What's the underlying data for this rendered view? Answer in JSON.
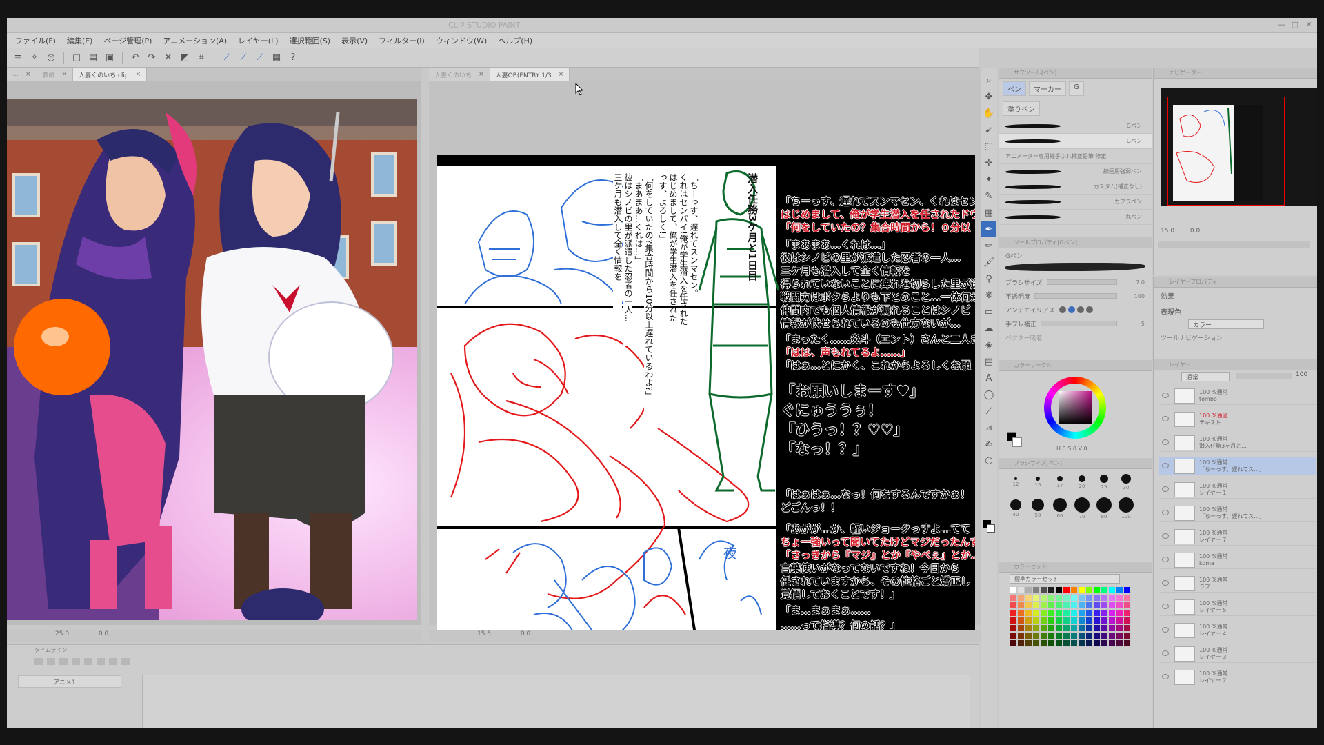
{
  "window": {
    "title": "CLIP STUDIO PAINT"
  },
  "menu": [
    "ファイル(F)",
    "編集(E)",
    "ページ管理(P)",
    "アニメーション(A)",
    "レイヤー(L)",
    "選択範囲(S)",
    "表示(V)",
    "フィルター(I)",
    "ウィンドウ(W)",
    "ヘルプ(H)"
  ],
  "left_doc": {
    "tabs": [
      {
        "label": "…",
        "close": "×"
      },
      {
        "label": "表紙",
        "close": "×"
      },
      {
        "label": "人妻くのいち.clip",
        "close": "×"
      }
    ],
    "status": {
      "zoom": "25.0",
      "angle": "0.0"
    }
  },
  "right_doc": {
    "tabs": [
      {
        "label": "人妻くのいち",
        "close": "×"
      },
      {
        "label": "人妻OB(ENTRY 1/3",
        "close": "×"
      }
    ],
    "status": {
      "zoom": "15.5",
      "angle": "0.0"
    },
    "vertical_text": {
      "title": "潜入任務3ケ月と1日目",
      "col1": "「ちーっす、遅れてスンマセン。",
      "col2": "くれはセンパイ!俺が学生潜入を任された",
      "col3": "はじめまして、俺が学生潜入を任された",
      "col4": "っす、よろしく!」",
      "col5": "「何をしていたの?集合時間から10分以上遅れているわよ?」",
      "col6": "「まあまあ…くれは…」",
      "col7": "彼はシノビの里が派遣した忍者の一人…",
      "col8": "三ケ月も潜入して全く情報を"
    },
    "dialogue_right": [
      {
        "text": "「ちーっす、遅れてスンマセン、くれはセンパ",
        "color": "black"
      },
      {
        "text": "はじめまして、俺が学生潜入を任されたドウ",
        "color": "red"
      },
      {
        "text": "「何をしていたの？集合時間から！０分以",
        "color": "red"
      },
      {
        "text": "「まあまあ…くれは…」",
        "color": "black"
      },
      {
        "text": "彼はシノビの里が派遣した忍者の一人…",
        "color": "black"
      },
      {
        "text": "三ケ月も潜入して全く情報を",
        "color": "black"
      },
      {
        "text": "得られていないことに痺れを切らした里が送",
        "color": "black"
      },
      {
        "text": "戦闘力はボクらよりも下とのこと…一体何が",
        "color": "black"
      },
      {
        "text": "仲間内でも個人情報が漏れることはシノビ",
        "color": "black"
      },
      {
        "text": "情報が伏せられているのも仕方ないが…",
        "color": "black"
      },
      {
        "text": "「まったく……炎斗（エント）さんと二人き",
        "color": "black"
      },
      {
        "text": "「はは、声もれてるよ……」",
        "color": "red"
      },
      {
        "text": "「はぁ…とにかく、これからよろしくお願",
        "color": "black"
      }
    ],
    "dialogue_big": [
      "「お願いしまーす♥」",
      "ぐにゅううぅ！",
      "「ひうっ！？♡♡」",
      "「なっ！？」"
    ],
    "dialogue_lower": [
      {
        "text": "「はぁはぁ…なっ！何をするんですかぁ！",
        "color": "black"
      },
      {
        "text": "どごんっ！！",
        "color": "black"
      },
      {
        "text": "「あがが…か、軽いジョークっすよ…てて",
        "color": "black"
      },
      {
        "text": "ちょ一強いって聞いてたけどマジだったんす",
        "color": "red"
      },
      {
        "text": "「さっきから『マジ』とか『やべぇ』とか…",
        "color": "red"
      },
      {
        "text": "言葉使いがなってないですね！今日から",
        "color": "black"
      },
      {
        "text": "任されていますから、その性格ごと矯正し",
        "color": "black"
      },
      {
        "text": "覚悟しておくことです！」",
        "color": "black"
      },
      {
        "text": "「ま…まぁまぁ……",
        "color": "black"
      },
      {
        "text": "……って指導？何の話？」",
        "color": "black"
      }
    ],
    "sketch_note": "夜"
  },
  "timeline": {
    "title": "タイムライン",
    "track": "アニメ1"
  },
  "subtool": {
    "header": "サブツール[ペン]",
    "tabs": [
      "ペン",
      "マーカー",
      "G"
    ],
    "tab_fill": "塗りペン",
    "brushes": [
      "Gペン",
      "Gペン",
      "アニメーター専用線手ぶれ補正鉛筆 修正",
      "線画用強弱ペン",
      "カスタム(補正なし)",
      "カブラペン",
      "丸ペン"
    ],
    "props_header": "ツールプロパティ[Gペン]",
    "props_name": "Gペン",
    "props": [
      {
        "label": "ブラシサイズ",
        "value": "7.0"
      },
      {
        "label": "不透明度",
        "value": "100"
      },
      {
        "label": "アンチエイリアス",
        "value": ""
      },
      {
        "label": "手ブレ補正",
        "value": "5"
      },
      {
        "label": "ベクター吸着",
        "value": ""
      }
    ],
    "color_header": "カラーサークル",
    "hsv": "H 0  S 0  V 0",
    "brushsize_header": "ブラシサイズ[ペン]",
    "brush_sizes": [
      "12",
      "15",
      "17",
      "20",
      "25",
      "30",
      "40",
      "50",
      "60",
      "70",
      "80",
      "100"
    ],
    "palette_header": "カラーセット",
    "palette_name": "標準カラーセット"
  },
  "navigator": {
    "header": "ナビゲーター",
    "zoom": "15.0",
    "angle": "0.0"
  },
  "layer_props": {
    "header": "レイヤープロパティ",
    "effect": "効果",
    "expression": "表現色",
    "expression_value": "カラー",
    "tool_nav": "ツールナビゲーション"
  },
  "layers": {
    "header": "レイヤー",
    "blend": "通常",
    "opacity": "100",
    "items": [
      {
        "line1": "100 %通常",
        "line2": "tombo"
      },
      {
        "line1": "100 %通過",
        "line2": "テキスト",
        "red": true
      },
      {
        "line1": "100 %通常",
        "line2": "潜入任務3ヶ月と…"
      },
      {
        "line1": "100 %通常",
        "line2": "「ちーっす、遅れてス…」",
        "selected": true
      },
      {
        "line1": "100 %通常",
        "line2": "レイヤー 1"
      },
      {
        "line1": "100 %通常",
        "line2": "「ちーっす、遅れてス…」"
      },
      {
        "line1": "100 %通常",
        "line2": "レイヤー 7"
      },
      {
        "line1": "100 %通常",
        "line2": "koma"
      },
      {
        "line1": "100 %通常",
        "line2": "ラフ"
      },
      {
        "line1": "100 %通常",
        "line2": "レイヤー 5"
      },
      {
        "line1": "100 %通常",
        "line2": "レイヤー 4"
      },
      {
        "line1": "100 %通常",
        "line2": "レイヤー 3"
      },
      {
        "line1": "100 %通常",
        "line2": "レイヤー 2"
      }
    ]
  },
  "colors": {
    "accent": "#3b6fbe",
    "red_text": "#d21e2a",
    "sketch_red": "#e3191b",
    "sketch_blue": "#2f6fd8",
    "sketch_green": "#0c6a2c",
    "panel": "#cfcfcf"
  }
}
